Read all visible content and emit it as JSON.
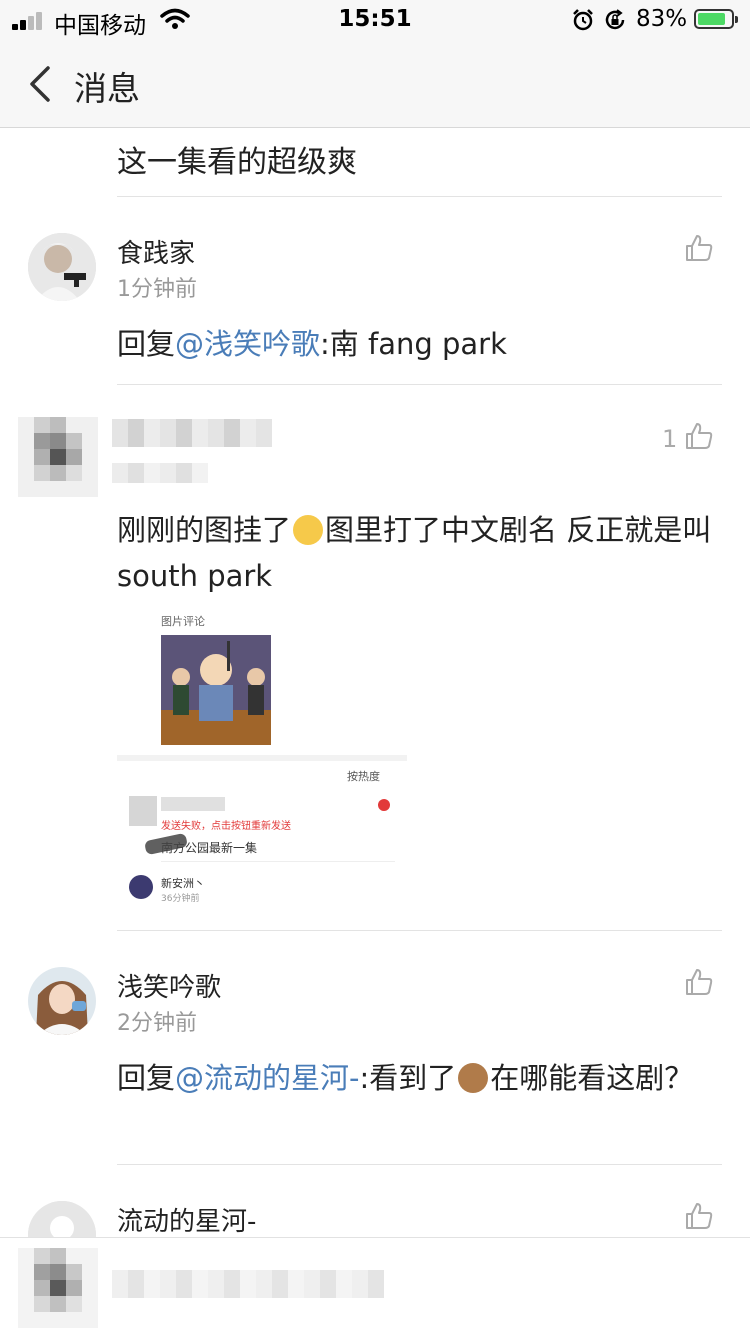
{
  "status_bar": {
    "carrier": "中国移动",
    "time": "15:51",
    "battery_percent": "83%",
    "battery_level": 0.83,
    "icons": [
      "signal-icon",
      "wifi-icon",
      "alarm-icon",
      "rotation-lock-icon",
      "battery-charging-icon"
    ]
  },
  "nav": {
    "title": "消息",
    "back_icon": "chevron-left-icon"
  },
  "top_text": "这一集看的超级爽",
  "comments": [
    {
      "username": "食践家",
      "time": "1分钟前",
      "reply_prefix": "回复",
      "mention": "@浅笑吟歌",
      "text": ":南 fang park",
      "like_icon": "thumbs-up-icon"
    },
    {
      "username": "",
      "time": "",
      "like_count": "1",
      "text_part1": "刚刚的图挂了",
      "emoji": "sweat-smile-emoji",
      "text_part2": "图里打了中文剧名 反正就是叫south park",
      "like_icon": "thumbs-up-icon",
      "image": {
        "caption": "图片评论",
        "sort_label": "按热度",
        "error_text": "发送失败，点击按钮重新发送",
        "sub_comment": "南方公园最新一集",
        "sub_user": "新安洲丶",
        "sub_time": "36分钟前"
      }
    },
    {
      "username": "浅笑吟歌",
      "time": "2分钟前",
      "reply_prefix": "回复",
      "mention": "@流动的星河-",
      "text_part1": ":看到了",
      "emoji": "see-no-evil-monkey-emoji",
      "text_part2": "在哪能看这剧？",
      "like_icon": "thumbs-up-icon"
    },
    {
      "username": "流动的星河-",
      "like_icon": "thumbs-up-icon"
    }
  ]
}
